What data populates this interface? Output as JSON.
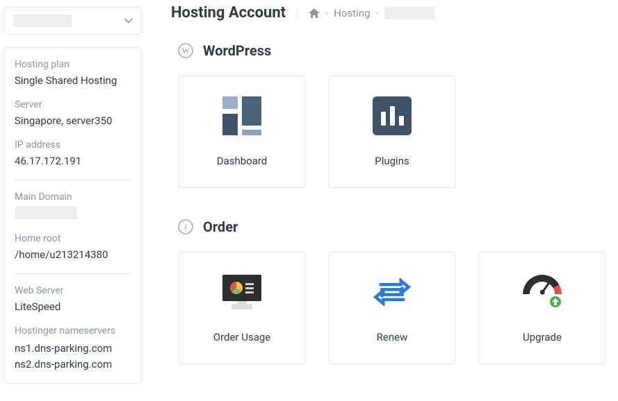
{
  "header": {
    "title": "Hosting Account",
    "breadcrumb": {
      "hosting": "Hosting"
    }
  },
  "sidebar": {
    "plan_label": "Hosting plan",
    "plan_value": "Single Shared Hosting",
    "server_label": "Server",
    "server_value": "Singapore, server350",
    "ip_label": "IP address",
    "ip_value": "46.17.172.191",
    "main_domain_label": "Main Domain",
    "home_root_label": "Home root",
    "home_root_value": "/home/u213214380",
    "web_server_label": "Web Server",
    "web_server_value": "LiteSpeed",
    "ns_label": "Hostinger nameservers",
    "ns1": "ns1.dns-parking.com",
    "ns2": "ns2.dns-parking.com"
  },
  "sections": {
    "wordpress": {
      "title": "WordPress",
      "cards": {
        "dashboard": "Dashboard",
        "plugins": "Plugins"
      }
    },
    "order": {
      "title": "Order",
      "cards": {
        "usage": "Order Usage",
        "renew": "Renew",
        "upgrade": "Upgrade"
      }
    }
  }
}
